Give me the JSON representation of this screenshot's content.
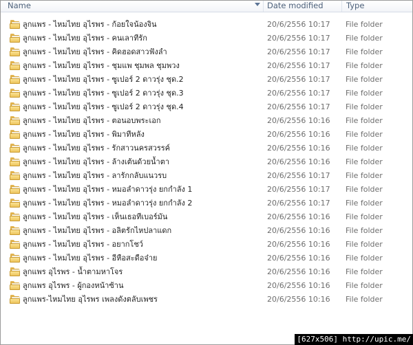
{
  "columns": {
    "name": "Name",
    "date": "Date modified",
    "type": "Type"
  },
  "files": [
    {
      "name": "ลูกแพร - ไหมไทย อุไรพร - ก้อยใจน้องจิน",
      "date": "20/6/2556 10:17",
      "type": "File folder"
    },
    {
      "name": "ลูกแพร - ไหมไทย อุไรพร - คนเลาทีรัก",
      "date": "20/6/2556 10:17",
      "type": "File folder"
    },
    {
      "name": "ลูกแพร - ไหมไทย อุไรพร - คิดฮอดสาวฟังลำ",
      "date": "20/6/2556 10:17",
      "type": "File folder"
    },
    {
      "name": "ลูกแพร - ไหมไทย อุไรพร - ชุมแพ ชุมพล ชุมพวง",
      "date": "20/6/2556 10:17",
      "type": "File folder"
    },
    {
      "name": "ลูกแพร - ไหมไทย อุไรพร - ซูเปอร์ 2 ดาวรุ่ง ชุด.2",
      "date": "20/6/2556 10:17",
      "type": "File folder"
    },
    {
      "name": "ลูกแพร - ไหมไทย อุไรพร - ซูเปอร์ 2 ดาวรุ่ง ชุด.3",
      "date": "20/6/2556 10:17",
      "type": "File folder"
    },
    {
      "name": "ลูกแพร - ไหมไทย อุไรพร - ซูเปอร์ 2 ดาวรุ่ง ชุด.4",
      "date": "20/6/2556 10:17",
      "type": "File folder"
    },
    {
      "name": "ลูกแพร - ไหมไทย อุไรพร - ตอนอบพระเอก",
      "date": "20/6/2556 10:16",
      "type": "File folder"
    },
    {
      "name": "ลูกแพร - ไหมไทย อุไรพร - พิมาทีหลัง",
      "date": "20/6/2556 10:16",
      "type": "File folder"
    },
    {
      "name": "ลูกแพร - ไหมไทย อุไรพร - รักสาวนครสวรรค์",
      "date": "20/6/2556 10:16",
      "type": "File folder"
    },
    {
      "name": "ลูกแพร - ไหมไทย อุไรพร - ล้างเต้นด้วยน้ำตา",
      "date": "20/6/2556 10:16",
      "type": "File folder"
    },
    {
      "name": "ลูกแพร - ไหมไทย อุไรพร - ลารักกลับแนวรบ",
      "date": "20/6/2556 10:17",
      "type": "File folder"
    },
    {
      "name": "ลูกแพร - ไหมไทย อุไรพร - หมอลำดาวรุ่ง ยกกำลัง 1",
      "date": "20/6/2556 10:17",
      "type": "File folder"
    },
    {
      "name": "ลูกแพร - ไหมไทย อุไรพร - หมอลำดาวรุ่ง ยกกำลัง 2",
      "date": "20/6/2556 10:17",
      "type": "File folder"
    },
    {
      "name": "ลูกแพร - ไหมไทย อุไรพร - เห็นเธอทีเบอร์มัน",
      "date": "20/6/2556 10:16",
      "type": "File folder"
    },
    {
      "name": "ลูกแพร - ไหมไทย อุไรพร - อลิตรักไหปลาแดก",
      "date": "20/6/2556 10:16",
      "type": "File folder"
    },
    {
      "name": "ลูกแพร - ไหมไทย อุไรพร - อยากโชว์",
      "date": "20/6/2556 10:16",
      "type": "File folder"
    },
    {
      "name": "ลูกแพร - ไหมไทย อุไรพร - อีหือสะดือจ๋าย",
      "date": "20/6/2556 10:16",
      "type": "File folder"
    },
    {
      "name": "ลูกแพร อุไรพร - น้ำตามหาโจร",
      "date": "20/6/2556 10:16",
      "type": "File folder"
    },
    {
      "name": "ลูกแพร อุไรพร - ผู้กองหน้าซ้าน",
      "date": "20/6/2556 10:16",
      "type": "File folder"
    },
    {
      "name": "ลูกแพร-ไหมไทย อุไรพร เพลงดังตลับเพชร",
      "date": "20/6/2556 10:16",
      "type": "File folder"
    }
  ],
  "icons": {
    "row_icon": "folder-icon",
    "sort_icon": "sort-down-arrow-icon"
  },
  "watermark": "[627x506] http://upic.me/"
}
